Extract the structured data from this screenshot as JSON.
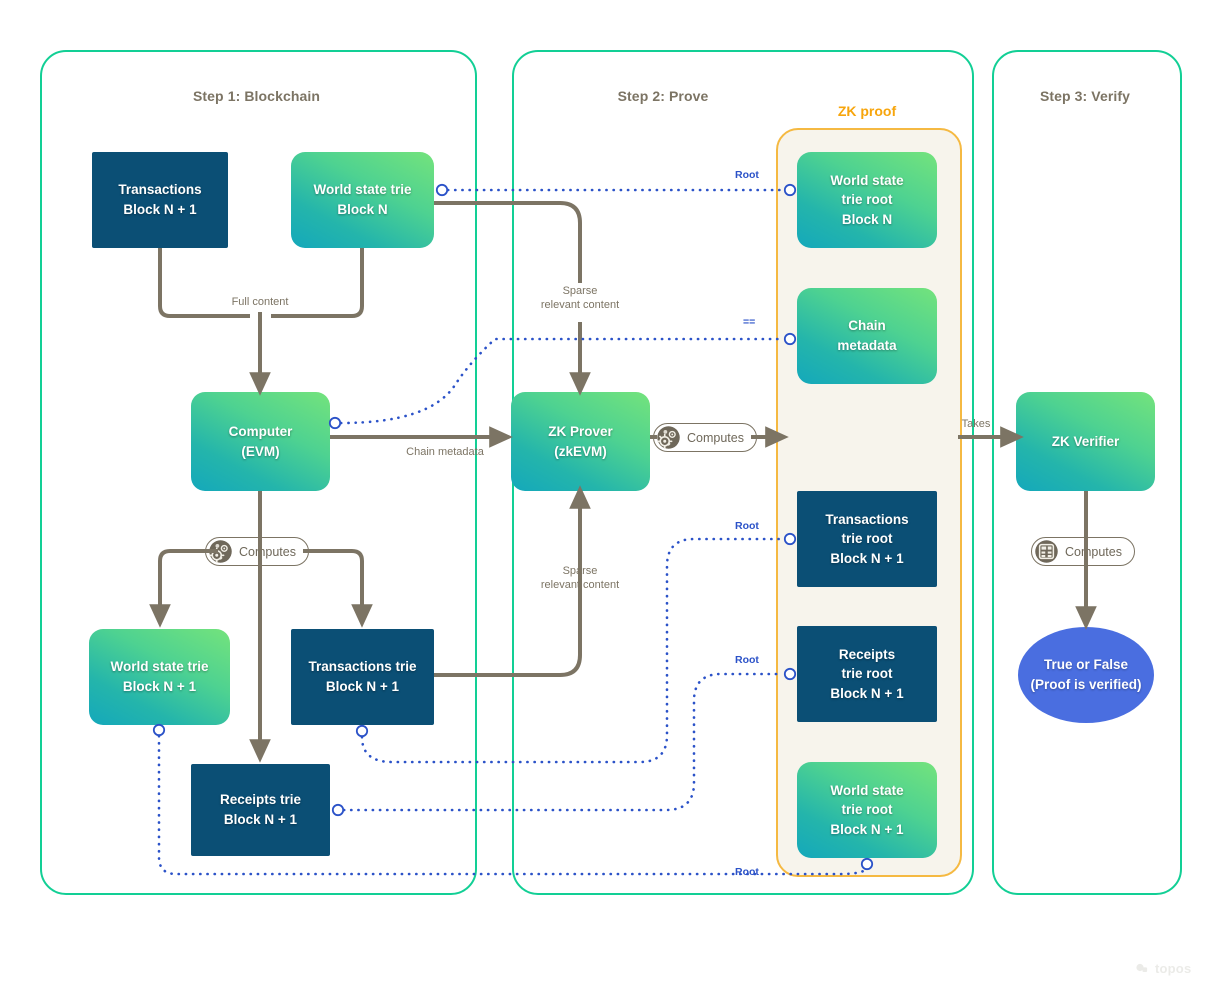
{
  "diagram": {
    "title_watermark": "topos",
    "colors": {
      "container_border": "#12cf95",
      "navy_node": "#0b4f75",
      "green_gradient_from": "#74e37c",
      "green_gradient_to": "#14a8bb",
      "result_ellipse": "#4a6ee0",
      "zk_panel_border": "#f5b942",
      "zk_panel_background": "#f7f4ec",
      "zk_proof_label": "#f7a50c",
      "solid_edge": "#7c7464",
      "dotted_edge": "#2b52c8",
      "step_title": "#7c7464"
    }
  },
  "steps": [
    {
      "id": "step1",
      "title": "Step 1: Blockchain"
    },
    {
      "id": "step2",
      "title": "Step 2: Prove"
    },
    {
      "id": "step3",
      "title": "Step 3: Verify"
    }
  ],
  "zk_proof": {
    "label": "ZK proof"
  },
  "nodes": {
    "transactions_block_n1": {
      "line1": "Transactions",
      "line2": "Block N + 1"
    },
    "world_state_trie_block_n": {
      "line1": "World state trie",
      "line2": "Block N"
    },
    "computer_evm": {
      "line1": "Computer",
      "line2": "(EVM)"
    },
    "world_state_trie_block_n1": {
      "line1": "World state trie",
      "line2": "Block N + 1"
    },
    "transactions_trie_block_n1": {
      "line1": "Transactions trie",
      "line2": "Block N + 1"
    },
    "receipts_trie_block_n1": {
      "line1": "Receipts trie",
      "line2": "Block N + 1"
    },
    "zk_prover": {
      "line1": "ZK Prover",
      "line2": "(zkEVM)"
    },
    "proof_world_state_root_n": {
      "line1": "World state",
      "line2": "trie root",
      "line3": "Block N"
    },
    "proof_chain_metadata": {
      "line1": "Chain",
      "line2": "metadata"
    },
    "proof_tx_trie_root_n1": {
      "line1": "Transactions",
      "line2": "trie root",
      "line3": "Block N + 1"
    },
    "proof_receipts_trie_root_n1": {
      "line1": "Receipts",
      "line2": "trie root",
      "line3": "Block N + 1"
    },
    "proof_world_state_root_n1": {
      "line1": "World state",
      "line2": "trie root",
      "line3": "Block N + 1"
    },
    "zk_verifier": {
      "line1": "ZK Verifier"
    },
    "result": {
      "line1": "True or False",
      "line2": "(Proof is verified)"
    }
  },
  "badges": {
    "computes_evm": {
      "label": "Computes",
      "icon": "gears-icon"
    },
    "computes_prover": {
      "label": "Computes",
      "icon": "gears-icon"
    },
    "computes_verifier": {
      "label": "Computes",
      "icon": "calculator-icon"
    }
  },
  "edge_labels": {
    "full_content": "Full content",
    "chain_metadata": "Chain metadata",
    "sparse_relevant_content_top": "Sparse\nrelevant content",
    "sparse_relevant_content_bottom": "Sparse\nrelevant content",
    "takes": "Takes",
    "root_state_n": "Root",
    "equals": "==",
    "root_tx_n1": "Root",
    "root_receipts_n1": "Root",
    "root_state_n1": "Root"
  }
}
